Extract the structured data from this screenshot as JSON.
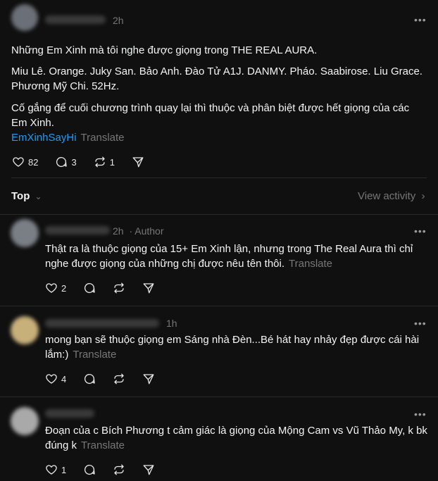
{
  "post": {
    "time": "2h",
    "paragraphs": [
      "Những Em Xinh mà tôi nghe được giọng trong THE REAL AURA.",
      "Miu Lê. Orange. Juky San. Bảo Anh. Đào Tử A1J. DANMY. Pháo. Saabirose. Liu Grace.",
      "Phương Mỹ Chi. 52Hz.",
      "Cố gắng để cuối chương trình quay lại thì thuộc và phân biệt được hết giọng của các",
      "Em Xinh."
    ],
    "hashtag": "EmXinhSayHi",
    "translate": "Translate",
    "likes": "82",
    "replies": "3",
    "reposts": "1"
  },
  "sort": {
    "label": "Top",
    "view_activity": "View activity"
  },
  "comments": [
    {
      "time": "2h",
      "author_badge": "· Author",
      "line1": "Thật ra là thuộc giọng của 15+ Em Xinh lận, nhưng trong The Real Aura thì chỉ",
      "line2": "nghe được giọng của những chị được nêu tên thôi.",
      "translate": "Translate",
      "likes": "2"
    },
    {
      "time": "1h",
      "line1": "mong bạn sẽ thuộc giọng em Sáng nhà Đèn...Bé hát hay nhảy đẹp được cái hài",
      "line2": "lắm:)",
      "translate": "Translate",
      "likes": "4"
    },
    {
      "line1": "Đoạn của c Bích Phương t cảm giác là giọng của Mộng Cam vs Vũ Thảo My, k bk",
      "line2": "đúng k",
      "translate": "Translate",
      "likes": "1"
    }
  ],
  "colors": {
    "background": "#101010",
    "link": "#1d9bf0",
    "muted": "#777777"
  }
}
